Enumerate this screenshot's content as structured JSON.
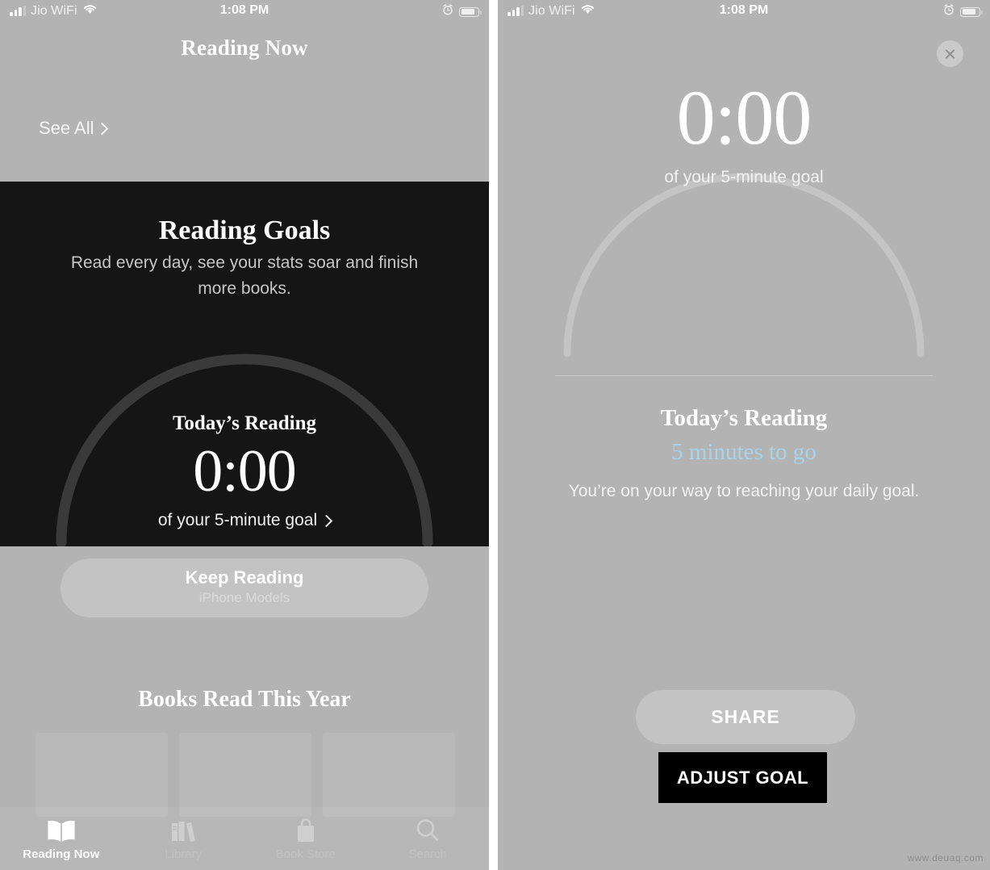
{
  "status_bar": {
    "carrier": "Jio WiFi",
    "time": "1:08 PM",
    "signal_icon": "cellular-signal-icon",
    "wifi_icon": "wifi-icon",
    "alarm_icon": "alarm-clock-icon",
    "battery_icon": "battery-icon"
  },
  "left_panel": {
    "nav_title": "Reading Now",
    "see_all": "See All",
    "goals_card": {
      "title": "Reading Goals",
      "subtitle": "Read every day, see your stats soar and finish more books.",
      "ring_label": "Today’s Reading",
      "ring_time": "0:00",
      "ring_goal": "of your 5-minute goal",
      "background": "#151515",
      "arc_color": "#3a3a3a"
    },
    "keep_reading": {
      "title": "Keep Reading",
      "subtitle": "iPhone Models"
    },
    "books_section_title": "Books Read This Year",
    "book_placeholders": [
      "",
      "",
      ""
    ],
    "tabs": [
      {
        "label": "Reading Now",
        "icon": "open-book-icon",
        "active": true
      },
      {
        "label": "Library",
        "icon": "books-shelf-icon",
        "active": false
      },
      {
        "label": "Book Store",
        "icon": "shopping-bag-icon",
        "active": false
      },
      {
        "label": "Search",
        "icon": "magnifier-icon",
        "active": false
      }
    ]
  },
  "right_panel": {
    "close_icon": "close-icon",
    "ring_time": "0:00",
    "ring_goal": "of your 5-minute goal",
    "today_label": "Today’s Reading",
    "time_to_go": "5 minutes to go",
    "time_to_go_color": "#a8d4e8",
    "encouragement": "You’re on your way to reaching your daily goal.",
    "share_label": "SHARE",
    "adjust_goal_label": "ADJUST GOAL"
  },
  "watermark": "www.deuaq.com"
}
